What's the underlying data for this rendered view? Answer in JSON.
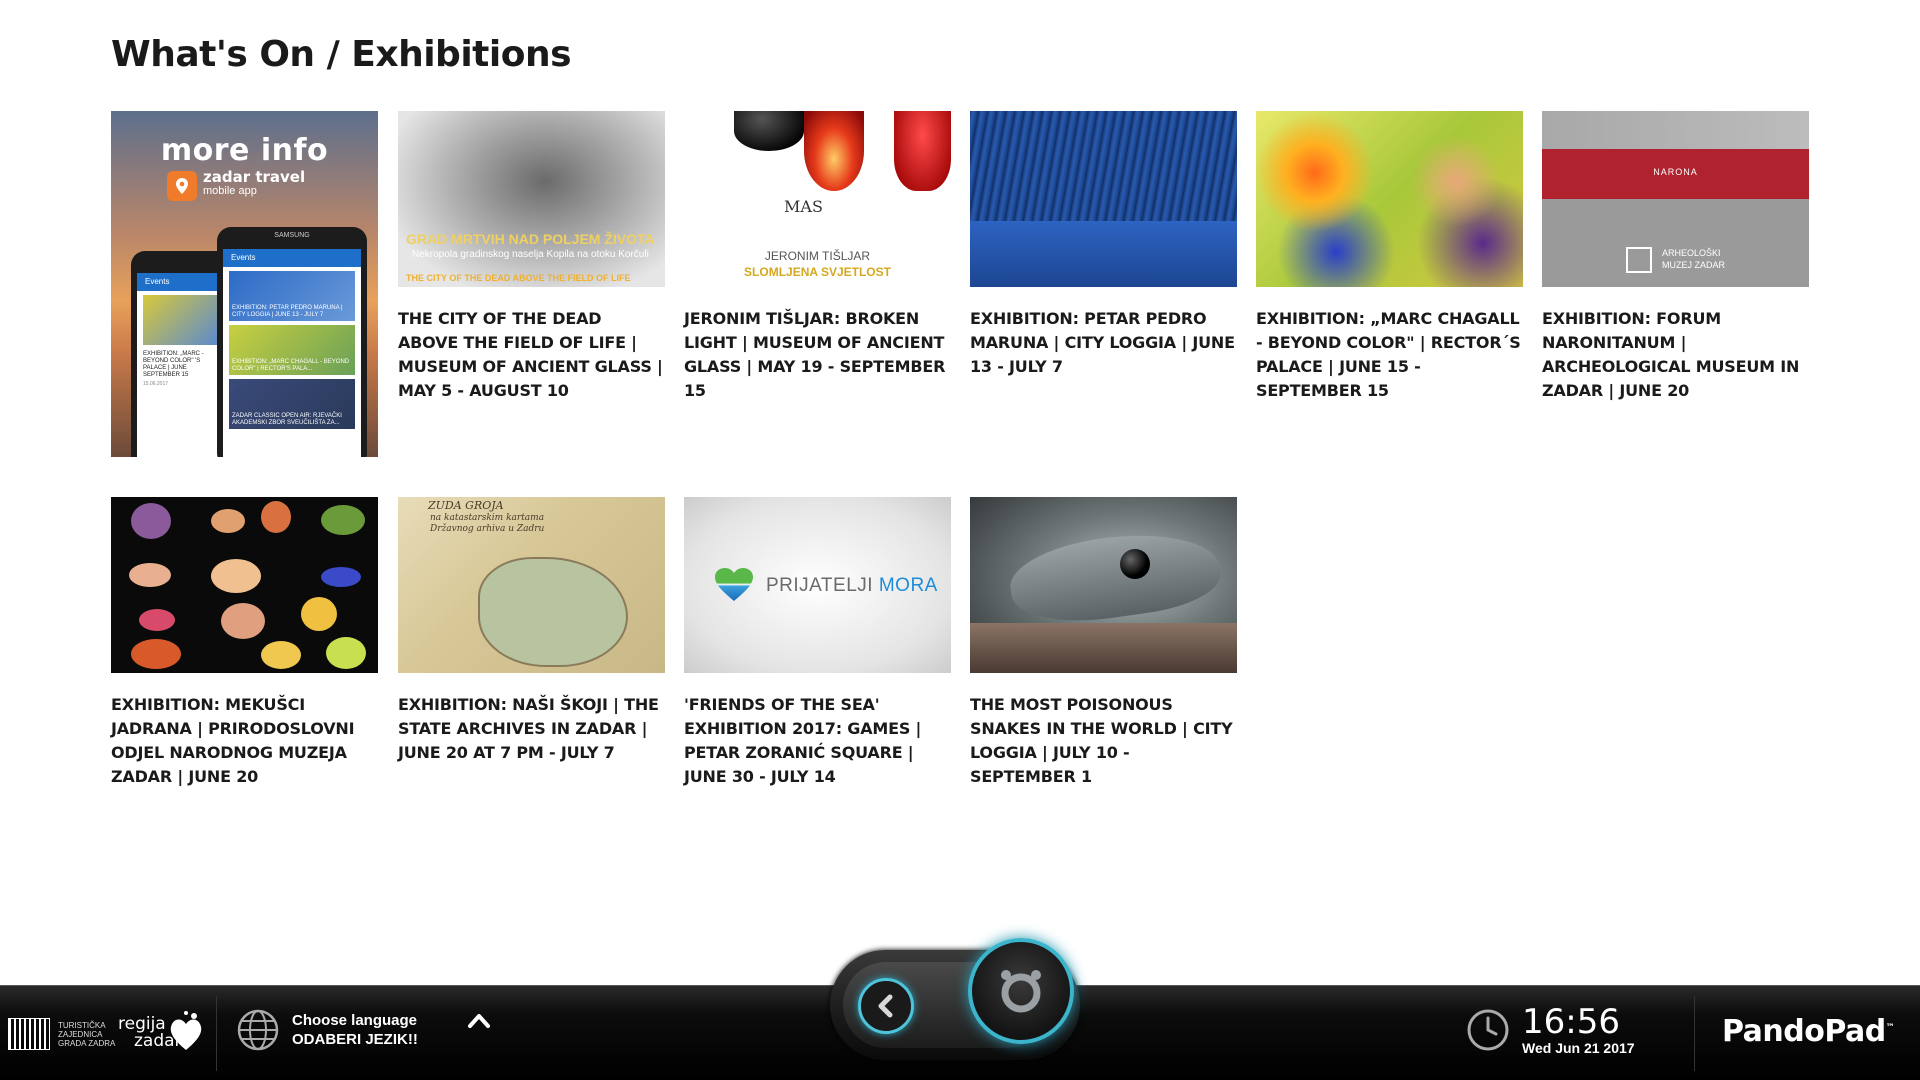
{
  "page": {
    "title": "What's On / Exhibitions"
  },
  "promo": {
    "title": "more info",
    "app_name": "zadar travel",
    "app_sub": "mobile app",
    "phone_brand": "SAMSUNG",
    "phone_bar": "Events",
    "tiles": [
      "EXHIBITION: PETAR PEDRO MARUNA | CITY LOGGIA | JUNE 13 - JULY 7",
      "EXHIBITION: „MARC CHAGALL - BEYOND COLOR\" | RECTOR'S PALA...",
      "ZADAR CLASSIC OPEN AIR: RJEVAČKI AKADEMSKI ZBOR SVEUČILIŠTA ZA..."
    ],
    "side_text": "EXHIBITION: „MARC - BEYOND COLOR\" 'S PALACE | JUNE SEPTEMBER 15",
    "side_date": "15.06.2017"
  },
  "thumbs": {
    "dead": {
      "cap1": "GRAD MRTVIH NAD POLJEM ŽIVOTA",
      "cap2": "Nekropola gradinskog naselja Kopila na otoku Korčuli",
      "cap3": "THE CITY OF THE DEAD ABOVE THE FIELD OF LIFE"
    },
    "glass": {
      "logo": "MAS",
      "name": "JERONIM TIŠLJAR",
      "sub": "SLOMLJENA SVJETLOST"
    },
    "narona": {
      "brand": "NARONA",
      "museum": "ARHEOLOŠKI MUZEJ ZADAR"
    },
    "map": {
      "t1": "ZUDA GROJA",
      "t2": "na katastarskim kartama Državnog arhiva u Zadru"
    },
    "sea": {
      "word1": "PRIJATELJI",
      "word2": "MORA"
    }
  },
  "events": [
    {
      "label": "THE CITY OF THE DEAD ABOVE THE FIELD OF LIFE | MUSEUM OF ANCIENT GLASS | MAY 5 - AUGUST 10"
    },
    {
      "label": "JERONIM TIŠLJAR: BROKEN LIGHT | MUSEUM OF ANCIENT GLASS | MAY 19 - SEPTEMBER 15"
    },
    {
      "label": "EXHIBITION: PETAR PEDRO MARUNA | CITY LOGGIA | JUNE 13 - JULY 7"
    },
    {
      "label": "EXHIBITION: „MARC CHAGALL - BEYOND COLOR\" | RECTOR´S PALACE | JUNE 15 - SEPTEMBER 15"
    },
    {
      "label": "EXHIBITION: FORUM NARONITANUM | ARCHEOLOGICAL MUSEUM IN ZADAR | JUNE 20"
    },
    {
      "label": "EXHIBITION: MEKUŠCI JADRANA | PRIRODOSLOVNI ODJEL NARODNOG MUZEJA ZADAR | JUNE 20"
    },
    {
      "label": "EXHIBITION: NAŠI ŠKOJI | THE STATE ARCHIVES IN ZADAR | JUNE 20 AT 7 PM - JULY 7"
    },
    {
      "label": "'FRIENDS OF THE SEA' EXHIBITION 2017: GAMES | PETAR ZORANIĆ SQUARE | JUNE 30 - JULY 14"
    },
    {
      "label": "THE MOST POISONOUS SNAKES IN THE WORLD | CITY LOGGIA | JULY 10 - SEPTEMBER 1"
    }
  ],
  "bottom_bar": {
    "tz_text": "TURISTIČKA ZAJEDNICA GRADA ZADRA",
    "regija_line1": "regija",
    "regija_line2": "zadar",
    "lang_line1": "Choose language",
    "lang_line2": "ODABERI JEZIK!!",
    "time": "16:56",
    "date": "Wed Jun 21 2017",
    "brand": "PandoPad",
    "brand_tm": "™",
    "accent": "#3bb4cc"
  }
}
